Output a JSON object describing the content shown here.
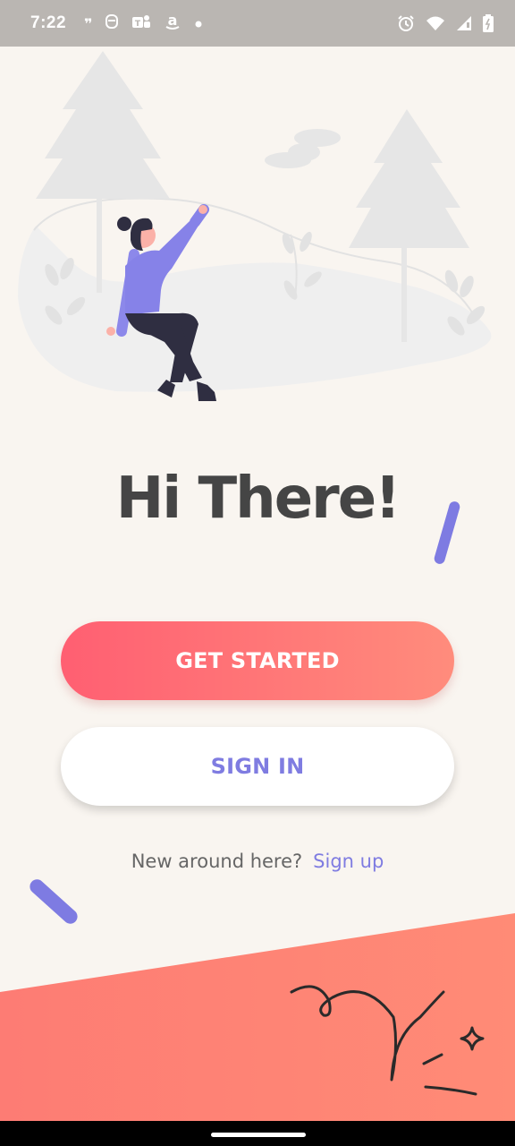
{
  "status_bar": {
    "time": "7:22",
    "left_icons": [
      "quote-icon",
      "mask-icon",
      "teams-icon",
      "amazon-icon",
      "dot-icon"
    ],
    "right_icons": [
      "alarm-icon",
      "wifi-icon",
      "signal-icon",
      "battery-icon"
    ]
  },
  "main": {
    "heading": "Hi There!",
    "get_started_label": "GET STARTED",
    "sign_in_label": "SIGN IN",
    "signup_prompt": "New around here?",
    "signup_link": "Sign up"
  },
  "colors": {
    "background": "#f9f5f0",
    "accent_purple": "#7f7ce1",
    "gradient_start": "#ff5f72",
    "gradient_end": "#ff8c7c",
    "heading_text": "#454545",
    "bottom_shape": "#ff8a78"
  }
}
